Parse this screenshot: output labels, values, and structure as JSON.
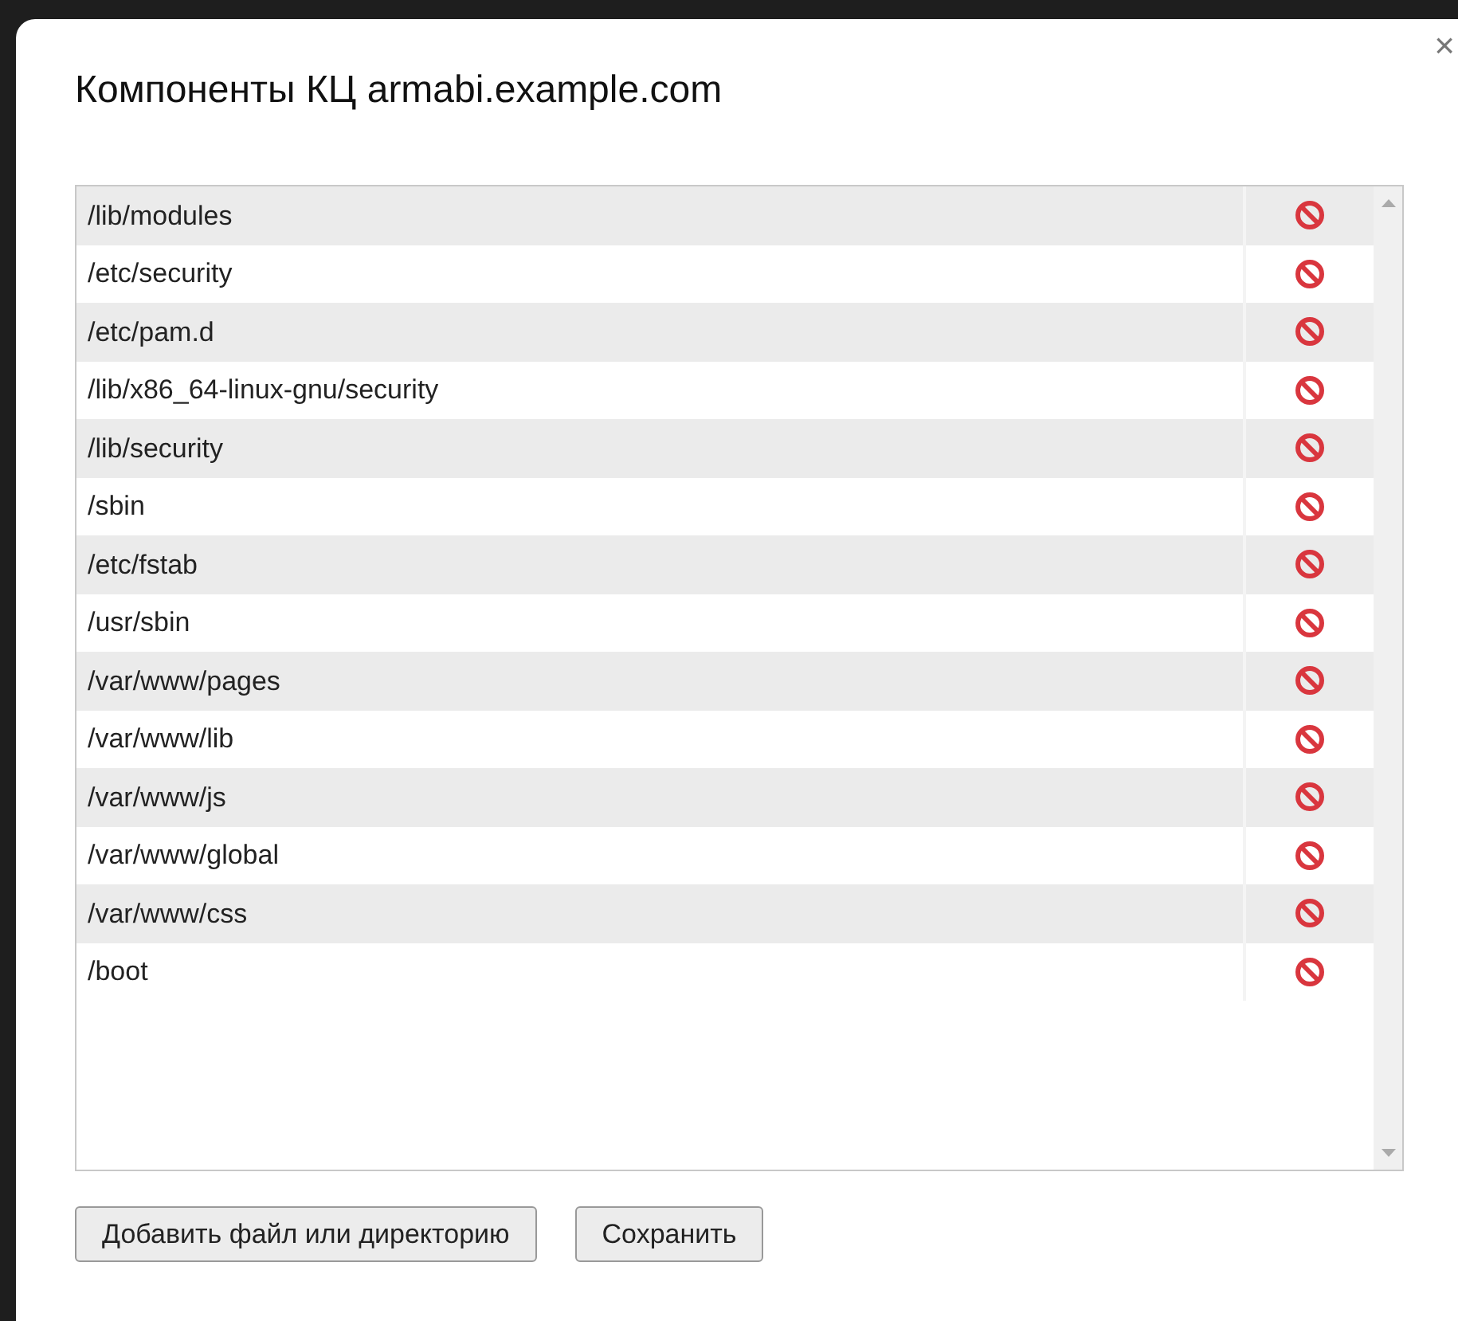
{
  "dialog": {
    "title": "Компоненты КЦ armabi.example.com",
    "close": "×"
  },
  "components": [
    {
      "path": "/lib/modules"
    },
    {
      "path": "/etc/security"
    },
    {
      "path": "/etc/pam.d"
    },
    {
      "path": "/lib/x86_64-linux-gnu/security"
    },
    {
      "path": "/lib/security"
    },
    {
      "path": "/sbin"
    },
    {
      "path": "/etc/fstab"
    },
    {
      "path": "/usr/sbin"
    },
    {
      "path": "/var/www/pages"
    },
    {
      "path": "/var/www/lib"
    },
    {
      "path": "/var/www/js"
    },
    {
      "path": "/var/www/global"
    },
    {
      "path": "/var/www/css"
    },
    {
      "path": "/boot"
    }
  ],
  "buttons": [
    "Добавить файл или директорию",
    "Сохранить"
  ]
}
